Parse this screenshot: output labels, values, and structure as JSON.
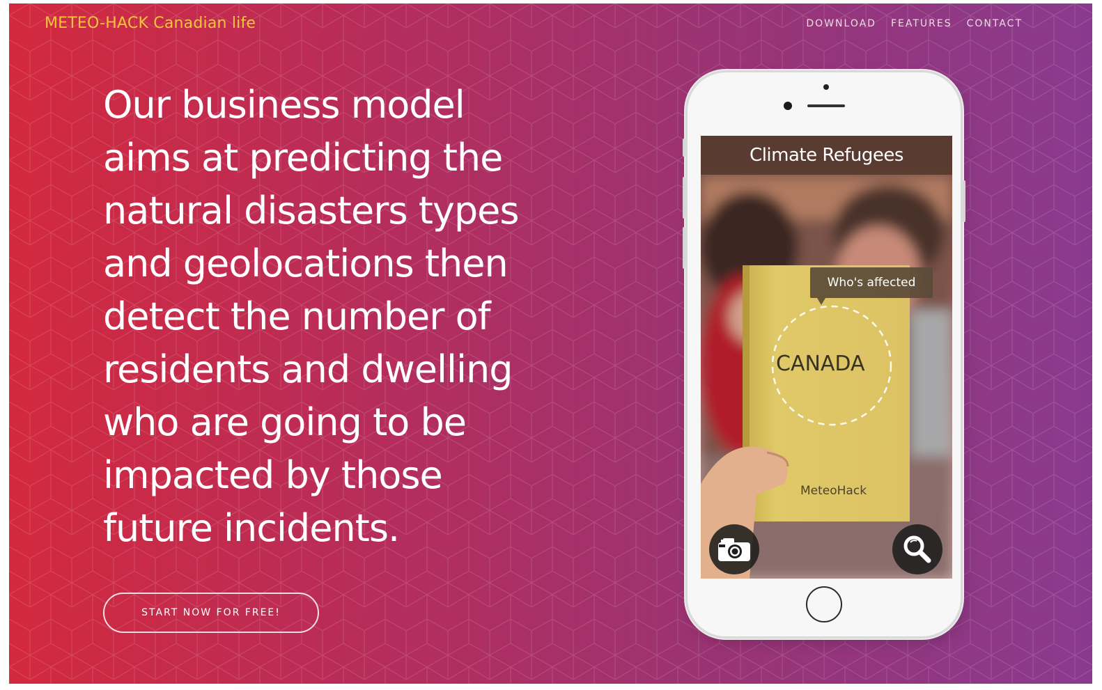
{
  "header": {
    "brand": "METEO-HACK Canadian life",
    "nav": [
      {
        "label": "DOWNLOAD"
      },
      {
        "label": "FEATURES"
      },
      {
        "label": "CONTACT"
      }
    ]
  },
  "hero": {
    "headline": "Our business model aims at predicting the natural disasters types and geolocations then detect the number of residents and dwelling who are going to be impacted by those future incidents.",
    "cta_label": "START NOW FOR FREE!"
  },
  "phone": {
    "app_title": "Climate Refugees",
    "tooltip": "Who's affected",
    "country_label": "CANADA",
    "book_brand": "MeteoHack",
    "camera_icon": "camera-icon",
    "search_icon": "search-icon"
  },
  "colors": {
    "gradient_left": "#d3293d",
    "gradient_right": "#8a3a8e",
    "brand": "#f4c53b",
    "text": "#ffffff"
  }
}
